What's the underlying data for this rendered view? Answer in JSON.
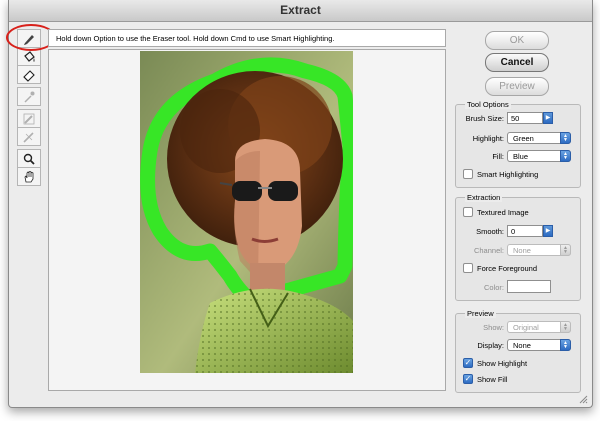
{
  "window": {
    "title": "Extract"
  },
  "hint": {
    "text": "Hold down Option to use the Eraser tool. Hold down Cmd to use Smart Highlighting."
  },
  "tools": [
    {
      "name": "edge-highlighter-tool",
      "icon": "marker-icon",
      "enabled": true,
      "selected": true
    },
    {
      "name": "fill-tool",
      "icon": "paint-bucket-icon",
      "enabled": true
    },
    {
      "name": "eraser-tool",
      "icon": "eraser-icon",
      "enabled": true
    },
    {
      "name": "eyedropper-tool",
      "icon": "eyedropper-icon",
      "enabled": false
    },
    {
      "name": "cleanup-tool",
      "icon": "cleanup-icon",
      "enabled": false
    },
    {
      "name": "edge-touchup-tool",
      "icon": "edge-touchup-icon",
      "enabled": false
    },
    {
      "name": "zoom-tool",
      "icon": "magnifier-icon",
      "enabled": true
    },
    {
      "name": "hand-tool",
      "icon": "hand-icon",
      "enabled": true
    }
  ],
  "buttons": {
    "ok": "OK",
    "cancel": "Cancel",
    "preview": "Preview"
  },
  "tool_options": {
    "title": "Tool Options",
    "brush_size_label": "Brush Size:",
    "brush_size_value": "50",
    "highlight_label": "Highlight:",
    "highlight_value": "Green",
    "fill_label": "Fill:",
    "fill_value": "Blue",
    "smart_highlighting_label": "Smart Highlighting",
    "smart_highlighting_checked": false
  },
  "extraction": {
    "title": "Extraction",
    "textured_image_label": "Textured Image",
    "textured_image_checked": false,
    "smooth_label": "Smooth:",
    "smooth_value": "0",
    "channel_label": "Channel:",
    "channel_value": "None",
    "force_foreground_label": "Force Foreground",
    "force_foreground_checked": false,
    "color_label": "Color:"
  },
  "preview": {
    "title": "Preview",
    "show_label": "Show:",
    "show_value": "Original",
    "display_label": "Display:",
    "display_value": "None",
    "show_highlight_label": "Show Highlight",
    "show_highlight_checked": true,
    "show_fill_label": "Show Fill",
    "show_fill_checked": true
  },
  "colors": {
    "highlight": "#37e626",
    "accent": "#2d6bc2",
    "annotation_ring": "#d8211b"
  }
}
